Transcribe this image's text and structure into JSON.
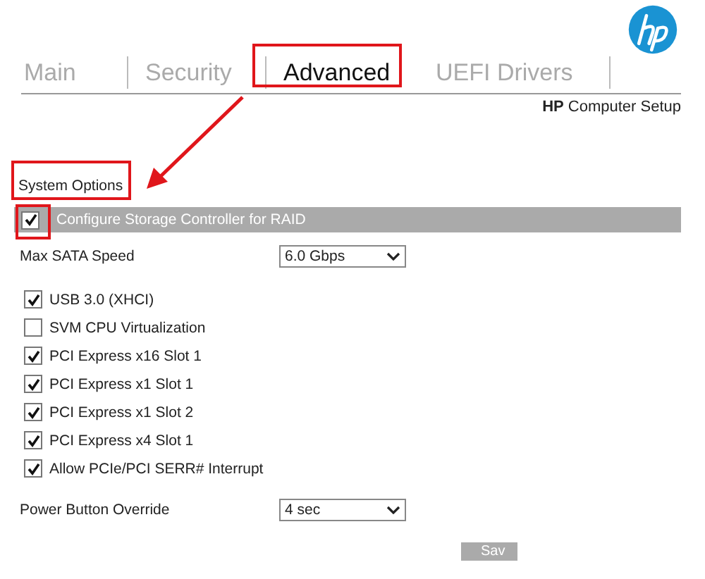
{
  "tabs": [
    {
      "label": "Main",
      "selected": false
    },
    {
      "label": "Security",
      "selected": false
    },
    {
      "label": "Advanced",
      "selected": true
    },
    {
      "label": "UEFI Drivers",
      "selected": false
    }
  ],
  "app_title": {
    "brand": "HP",
    "rest": "Computer Setup"
  },
  "section_title": "System Options",
  "header_option": {
    "label": "Configure Storage Controller for RAID",
    "checked": true
  },
  "max_sata": {
    "label": "Max SATA Speed",
    "value": "6.0 Gbps"
  },
  "options": [
    {
      "label": "USB 3.0 (XHCI)",
      "checked": true
    },
    {
      "label": "SVM CPU Virtualization",
      "checked": false
    },
    {
      "label": "PCI Express x16 Slot 1",
      "checked": true
    },
    {
      "label": "PCI Express x1 Slot 1",
      "checked": true
    },
    {
      "label": "PCI Express x1 Slot 2",
      "checked": true
    },
    {
      "label": "PCI Express x4 Slot 1",
      "checked": true
    },
    {
      "label": "Allow PCIe/PCI SERR# Interrupt",
      "checked": true
    }
  ],
  "power_button": {
    "label": "Power Button Override",
    "value": "4 sec"
  },
  "save_button": "Sav"
}
